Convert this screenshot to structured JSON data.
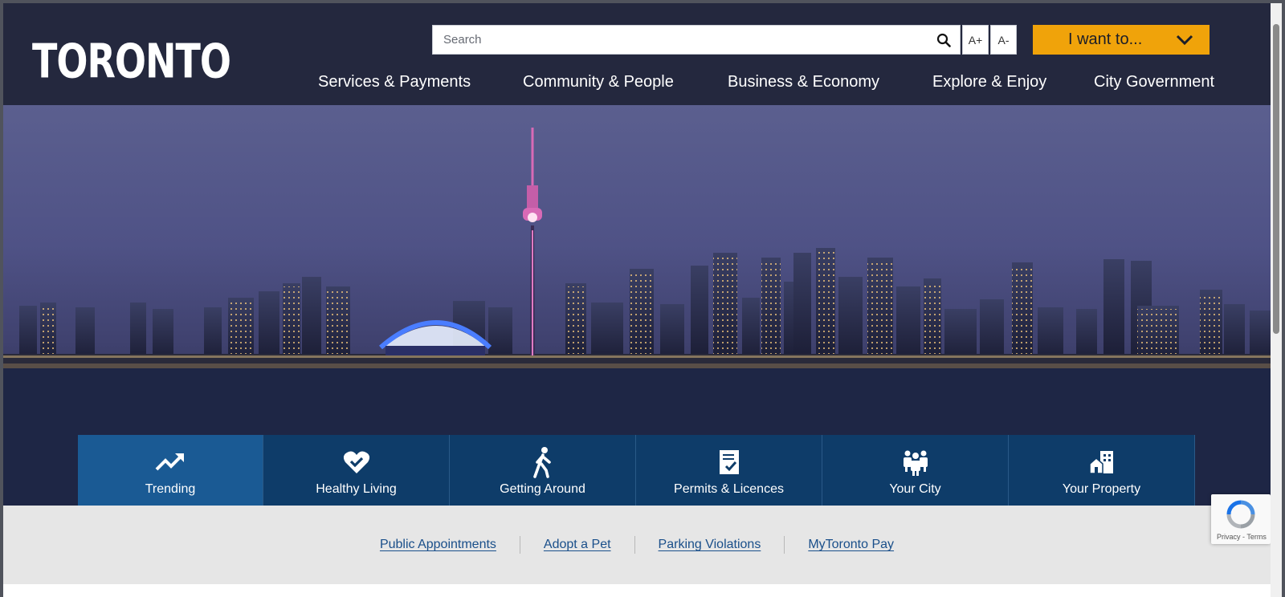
{
  "header": {
    "logo_text": "TORONTO",
    "search": {
      "placeholder": "Search",
      "value": ""
    },
    "font_increase_label": "A+",
    "font_decrease_label": "A-",
    "i_want_to_label": "I want to...",
    "nav": [
      {
        "label": "Services & Payments"
      },
      {
        "label": "Community & People"
      },
      {
        "label": "Business & Economy"
      },
      {
        "label": "Explore & Enjoy"
      },
      {
        "label": "City Government"
      }
    ]
  },
  "hero": {
    "image": "toronto-skyline-night"
  },
  "categories": [
    {
      "label": "Trending",
      "icon": "trending-icon",
      "active": true
    },
    {
      "label": "Healthy Living",
      "icon": "heart-check-icon",
      "active": false
    },
    {
      "label": "Getting Around",
      "icon": "walking-person-icon",
      "active": false
    },
    {
      "label": "Permits & Licences",
      "icon": "clipboard-check-icon",
      "active": false
    },
    {
      "label": "Your City",
      "icon": "people-group-icon",
      "active": false
    },
    {
      "label": "Your Property",
      "icon": "house-building-icon",
      "active": false
    }
  ],
  "quick_links": [
    {
      "label": "Public Appointments"
    },
    {
      "label": "Adopt a Pet"
    },
    {
      "label": "Parking Violations"
    },
    {
      "label": "MyToronto Pay"
    }
  ],
  "recaptcha": {
    "terms": "Privacy - Terms"
  },
  "colors": {
    "header_bg": "#24283e",
    "accent": "#f0a30a",
    "tab_bg": "#0e3c69",
    "tab_active": "#1a5a94",
    "link": "#1a4f8a",
    "quick_bar_bg": "#e6e6e6"
  }
}
